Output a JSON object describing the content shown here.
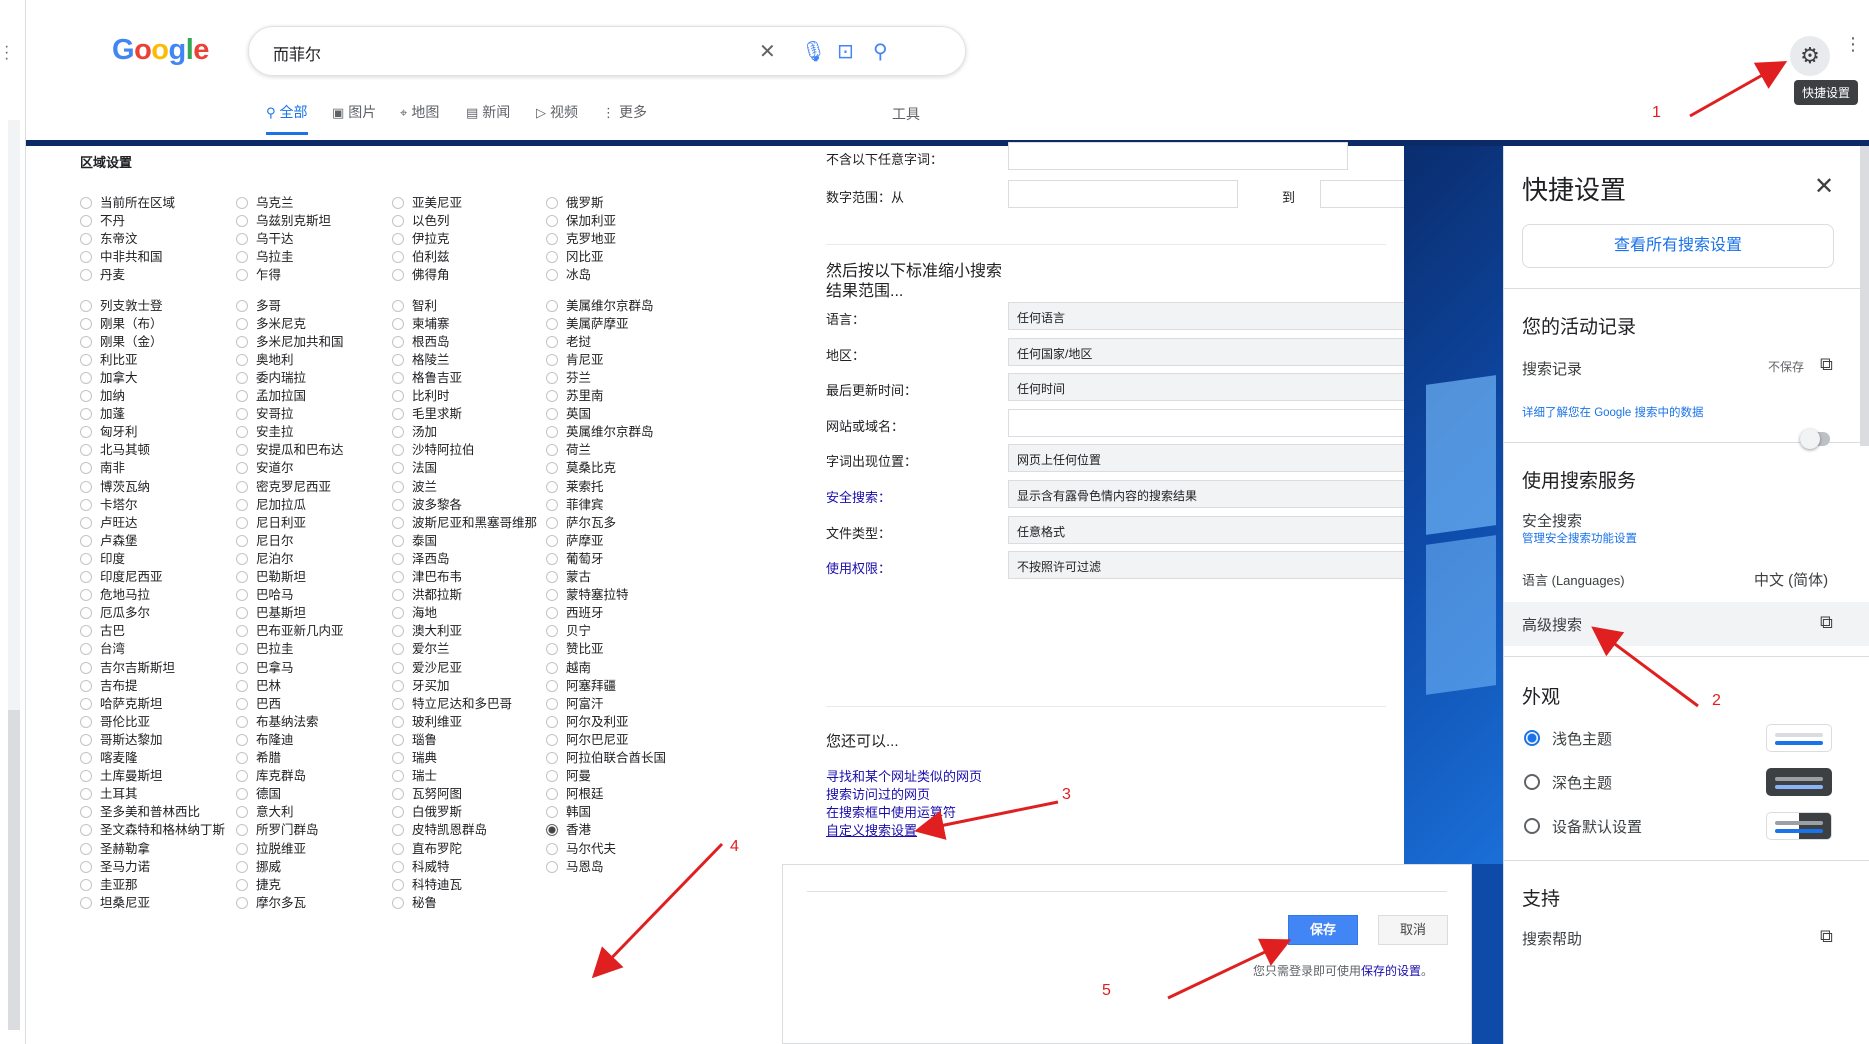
{
  "search": {
    "query": "而菲尔"
  },
  "tabs": [
    {
      "label": "全部",
      "icon": "search-icon"
    },
    {
      "label": "图片",
      "icon": "image-icon"
    },
    {
      "label": "地图",
      "icon": "map-pin-icon"
    },
    {
      "label": "新闻",
      "icon": "news-icon"
    },
    {
      "label": "视频",
      "icon": "video-icon"
    },
    {
      "label": "更多",
      "icon": "more-icon"
    }
  ],
  "tools_label": "工具",
  "tooltip": "快捷设置",
  "region": {
    "title": "区域设置",
    "col1": [
      "当前所在区域",
      "不丹",
      "东帝汶",
      "中非共和国",
      "丹麦",
      "列支敦士登",
      "刚果（布）",
      "刚果（金）",
      "利比亚",
      "加拿大",
      "加纳",
      "加蓬",
      "匈牙利",
      "北马其顿",
      "南非",
      "博茨瓦纳",
      "卡塔尔",
      "卢旺达",
      "卢森堡",
      "印度",
      "印度尼西亚",
      "危地马拉",
      "厄瓜多尔",
      "古巴",
      "台湾",
      "吉尔吉斯斯坦",
      "吉布提",
      "哈萨克斯坦",
      "哥伦比亚",
      "哥斯达黎加",
      "喀麦隆",
      "土库曼斯坦",
      "土耳其",
      "圣多美和普林西比",
      "圣文森特和格林纳丁斯",
      "圣赫勒拿",
      "圣马力诺",
      "圭亚那",
      "坦桑尼亚"
    ],
    "col2": [
      "乌克兰",
      "乌兹别克斯坦",
      "乌干达",
      "乌拉圭",
      "乍得",
      "多哥",
      "多米尼克",
      "多米尼加共和国",
      "奥地利",
      "委内瑞拉",
      "孟加拉国",
      "安哥拉",
      "安圭拉",
      "安提瓜和巴布达",
      "安道尔",
      "密克罗尼西亚",
      "尼加拉瓜",
      "尼日利亚",
      "尼日尔",
      "尼泊尔",
      "巴勒斯坦",
      "巴哈马",
      "巴基斯坦",
      "巴布亚新几内亚",
      "巴拉圭",
      "巴拿马",
      "巴林",
      "巴西",
      "布基纳法索",
      "布隆迪",
      "希腊",
      "库克群岛",
      "德国",
      "意大利",
      "所罗门群岛",
      "拉脱维亚",
      "挪威",
      "捷克",
      "摩尔多瓦"
    ],
    "col3": [
      "亚美尼亚",
      "以色列",
      "伊拉克",
      "伯利兹",
      "佛得角",
      "智利",
      "柬埔寨",
      "根西岛",
      "格陵兰",
      "格鲁吉亚",
      "比利时",
      "毛里求斯",
      "汤加",
      "沙特阿拉伯",
      "法国",
      "波兰",
      "波多黎各",
      "波斯尼亚和黑塞哥维那",
      "泰国",
      "泽西岛",
      "津巴布韦",
      "洪都拉斯",
      "海地",
      "澳大利亚",
      "爱尔兰",
      "爱沙尼亚",
      "牙买加",
      "特立尼达和多巴哥",
      "玻利维亚",
      "瑙鲁",
      "瑞典",
      "瑞士",
      "瓦努阿图",
      "白俄罗斯",
      "皮特凯恩群岛",
      "直布罗陀",
      "科威特",
      "科特迪瓦",
      "秘鲁"
    ],
    "col4": [
      "俄罗斯",
      "保加利亚",
      "克罗地亚",
      "冈比亚",
      "冰岛",
      "美属维尔京群岛",
      "美属萨摩亚",
      "老挝",
      "肯尼亚",
      "芬兰",
      "苏里南",
      "英国",
      "英属维尔京群岛",
      "荷兰",
      "莫桑比克",
      "莱索托",
      "菲律宾",
      "萨尔瓦多",
      "萨摩亚",
      "葡萄牙",
      "蒙古",
      "蒙特塞拉特",
      "西班牙",
      "贝宁",
      "赞比亚",
      "越南",
      "阿塞拜疆",
      "阿富汗",
      "阿尔及利亚",
      "阿尔巴尼亚",
      "阿拉伯联合酋长国",
      "阿曼",
      "阿根廷",
      "韩国",
      "香港",
      "马尔代夫",
      "马恩岛"
    ],
    "selected": "香港"
  },
  "form": {
    "rows": [
      {
        "label": "不含以下任意字词：",
        "value": ""
      },
      {
        "label": "数字范围：从",
        "value": "",
        "to": "到"
      }
    ],
    "narrow_title": "然后按以下标准缩小搜索结果范围...",
    "filters": [
      {
        "label": "语言：",
        "value": "任何语言",
        "link": false
      },
      {
        "label": "地区：",
        "value": "任何国家/地区",
        "link": false
      },
      {
        "label": "最后更新时间：",
        "value": "任何时间",
        "link": false
      },
      {
        "label": "网站或域名：",
        "value": "",
        "link": false
      },
      {
        "label": "字词出现位置：",
        "value": "网页上任何位置",
        "link": false
      },
      {
        "label": "安全搜索：",
        "value": "显示含有露骨色情内容的搜索结果",
        "link": true
      },
      {
        "label": "文件类型：",
        "value": "任意格式",
        "link": false
      },
      {
        "label": "使用权限：",
        "value": "不按照许可过滤",
        "link": true
      }
    ],
    "also_title": "您还可以...",
    "also_links": [
      "寻找和某个网址类似的网页",
      "搜索访问过的网页",
      "在搜索框中使用运算符",
      "自定义搜索设置"
    ]
  },
  "save_dialog": {
    "save": "保存",
    "cancel": "取消",
    "note_prefix": "您只需登录即可使用",
    "note_link": "保存的设置",
    "note_suffix": "。"
  },
  "quick_settings": {
    "title": "快捷设置",
    "all_settings": "查看所有搜索设置",
    "activity_title": "您的活动记录",
    "history_label": "搜索记录",
    "history_value": "不保存",
    "data_link": "详细了解您在 Google 搜索中的数据",
    "services_title": "使用搜索服务",
    "safe_label": "安全搜索",
    "safe_link": "管理安全搜索功能设置",
    "lang_label": "语言 (Languages)",
    "lang_value": "中文 (简体)",
    "advanced_label": "高级搜索",
    "appearance_title": "外观",
    "themes": [
      "浅色主题",
      "深色主题",
      "设备默认设置"
    ],
    "support_title": "支持",
    "help_label": "搜索帮助"
  },
  "annotations": [
    "1",
    "2",
    "3",
    "4",
    "5"
  ],
  "colors": {
    "accent": "#1a73e8",
    "annotation": "#e02020",
    "save_button": "#4285f4"
  }
}
